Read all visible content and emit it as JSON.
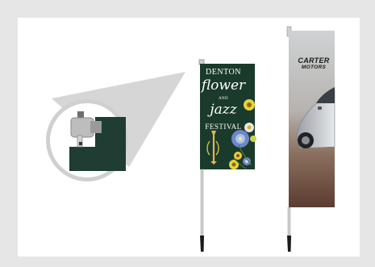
{
  "flags": {
    "festival": {
      "line1": "DENTON",
      "line2": "flower",
      "line3": "AND",
      "line4": "jazz",
      "line5": "FESTIVAL",
      "flag_color": "#1a3a2c"
    },
    "motors": {
      "line1": "CARTER",
      "line2": "MOTORS",
      "text_color": "#1a1a1a"
    }
  },
  "icons": {
    "detail": "bracket-mount-icon",
    "instrument": "trumpet-icon",
    "flowers": "flower-icon",
    "car": "car-icon"
  },
  "colors": {
    "background": "#e6e6e6",
    "panel": "#ffffff",
    "dark_green": "#1a3a2c",
    "pole": "#cfcfcf"
  }
}
